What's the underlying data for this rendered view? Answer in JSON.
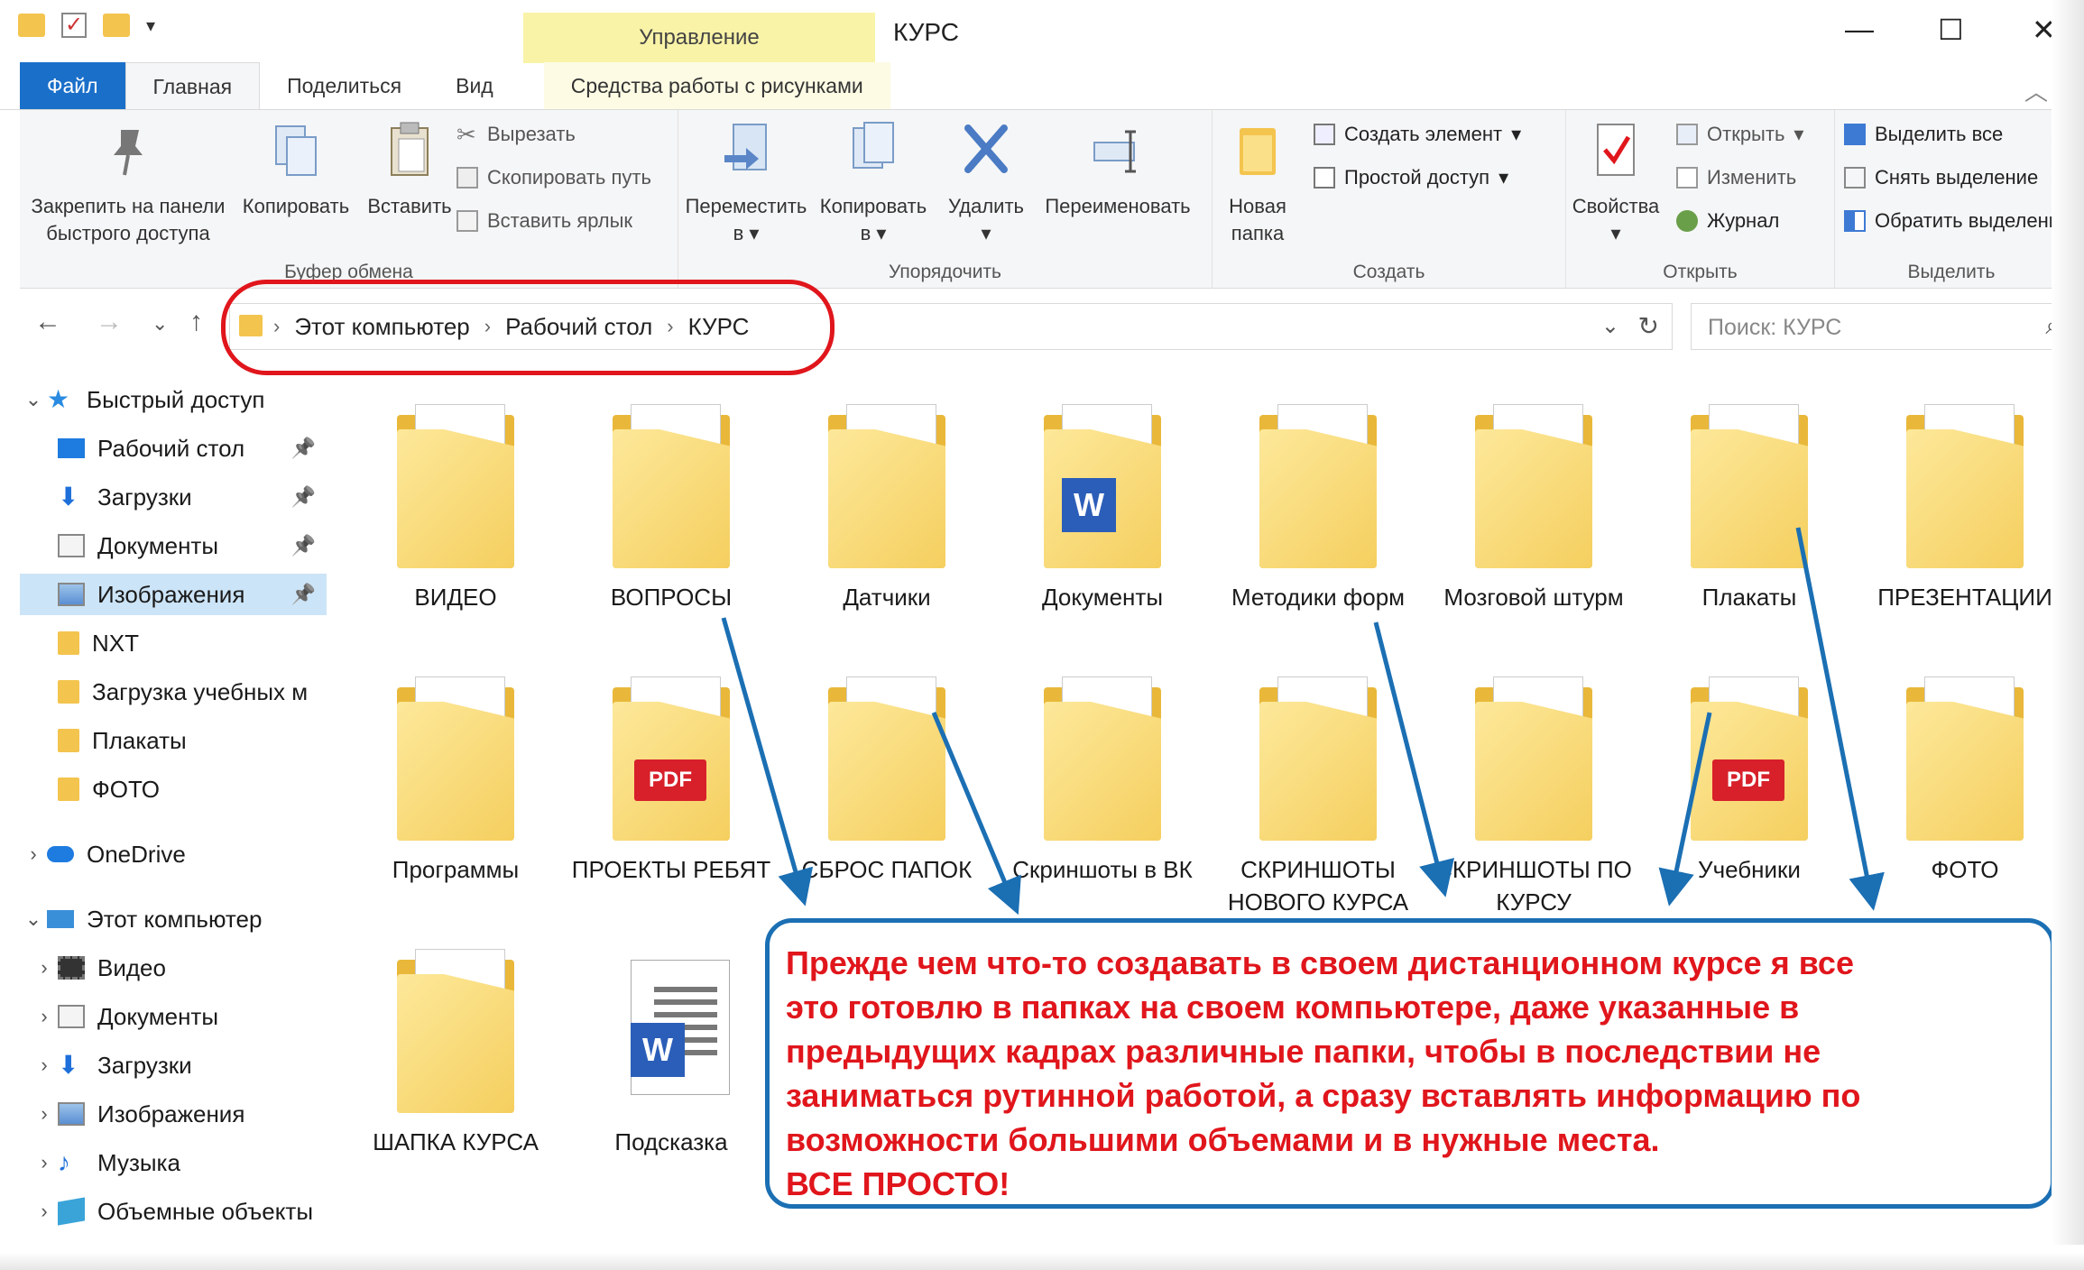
{
  "window": {
    "title": "КУРС",
    "context_tab": "Управление",
    "controls": {
      "minimize": "—",
      "maximize": "☐",
      "close": "✕"
    }
  },
  "tabs": [
    "Файл",
    "Главная",
    "Поделиться",
    "Вид",
    "Средства работы с рисунками"
  ],
  "ribbon": {
    "clipboard": {
      "group": "Буфер обмена",
      "pin": "Закрепить на панели быстрого доступа",
      "pin_l1": "Закрепить на панели",
      "pin_l2": "быстрого доступа",
      "copy": "Копировать",
      "paste": "Вставить",
      "cut": "Вырезать",
      "copy_path": "Скопировать путь",
      "paste_shortcut": "Вставить ярлык"
    },
    "organize": {
      "group": "Упорядочить",
      "move_l1": "Переместить",
      "move_l2": "в",
      "copy_l1": "Копировать",
      "copy_l2": "в",
      "delete": "Удалить",
      "rename": "Переименовать"
    },
    "create": {
      "group": "Создать",
      "new_folder_l1": "Новая",
      "new_folder_l2": "папка",
      "new_item": "Создать элемент",
      "easy_access": "Простой доступ"
    },
    "open": {
      "group": "Открыть",
      "properties": "Свойства",
      "open": "Открыть",
      "edit": "Изменить",
      "history": "Журнал"
    },
    "select": {
      "group": "Выделить",
      "select_all": "Выделить все",
      "select_none": "Снять выделение",
      "invert": "Обратить выделение"
    }
  },
  "address": {
    "crumbs": [
      "Этот компьютер",
      "Рабочий стол",
      "КУРС"
    ],
    "search_placeholder": "Поиск: КУРС"
  },
  "nav": [
    {
      "label": "Быстрый доступ",
      "icon": "star-icon",
      "expander": "⌄",
      "level": 0
    },
    {
      "label": "Рабочий стол",
      "icon": "desktop-icon",
      "pinned": true,
      "level": 1
    },
    {
      "label": "Загрузки",
      "icon": "download-icon",
      "pinned": true,
      "level": 1
    },
    {
      "label": "Документы",
      "icon": "documents-icon",
      "pinned": true,
      "level": 1
    },
    {
      "label": "Изображения",
      "icon": "pictures-icon",
      "pinned": true,
      "level": 1,
      "selected": true
    },
    {
      "label": "NXT",
      "icon": "folder-icon",
      "level": 1
    },
    {
      "label": "Загрузка учебных м",
      "icon": "folder-icon",
      "level": 1
    },
    {
      "label": "Плакаты",
      "icon": "folder-icon",
      "level": 1
    },
    {
      "label": "ФОТО",
      "icon": "folder-icon",
      "level": 1
    },
    {
      "label": "OneDrive",
      "icon": "onedrive-icon",
      "expander": "›",
      "level": 0
    },
    {
      "label": "Этот компьютер",
      "icon": "computer-icon",
      "expander": "⌄",
      "level": 0
    },
    {
      "label": "Видео",
      "icon": "video-icon",
      "expander": "›",
      "level": 1
    },
    {
      "label": "Документы",
      "icon": "documents-icon",
      "expander": "›",
      "level": 1
    },
    {
      "label": "Загрузки",
      "icon": "download-icon",
      "expander": "›",
      "level": 1
    },
    {
      "label": "Изображения",
      "icon": "pictures-icon",
      "expander": "›",
      "level": 1
    },
    {
      "label": "Музыка",
      "icon": "music-icon",
      "expander": "›",
      "level": 1
    },
    {
      "label": "Объемные объекты",
      "icon": "3d-objects-icon",
      "expander": "›",
      "level": 1
    }
  ],
  "folders": [
    {
      "label": "ВИДЕО",
      "type": "folder"
    },
    {
      "label": "ВОПРОСЫ",
      "type": "folder"
    },
    {
      "label": "Датчики",
      "type": "folder"
    },
    {
      "label": "Документы",
      "type": "folder",
      "badge": "W"
    },
    {
      "label": "Методики форм",
      "type": "folder"
    },
    {
      "label": "Мозговой штурм",
      "type": "folder"
    },
    {
      "label": "Плакаты",
      "type": "folder"
    },
    {
      "label": "ПРЕЗЕНТАЦИИ",
      "type": "folder"
    },
    {
      "label": "Программы",
      "type": "folder"
    },
    {
      "label": "ПРОЕКТЫ РЕБЯТ",
      "type": "folder",
      "badge": "PDF"
    },
    {
      "label": "СБРОС ПАПОК",
      "type": "folder"
    },
    {
      "label": "Скриншоты в ВК",
      "type": "folder"
    },
    {
      "label": "СКРИНШОТЫ НОВОГО КУРСА",
      "type": "folder"
    },
    {
      "label": "СКРИНШОТЫ ПО КУРСУ",
      "type": "folder"
    },
    {
      "label": "Учебники",
      "type": "folder",
      "badge": "PDF"
    },
    {
      "label": "ФОТО",
      "type": "folder"
    },
    {
      "label": "ШАПКА КУРСА",
      "type": "folder"
    },
    {
      "label": "Подсказка",
      "type": "word-file",
      "badge": "W"
    }
  ],
  "callout": {
    "line1": "Прежде чем что-то создавать в своем дистанционном курсе я все",
    "line2": "это готовлю в папках на своем компьютере, даже указанные в",
    "line3": "предыдущих кадрах различные папки, чтобы в последствии не",
    "line4": "заниматься рутинной работой, а сразу вставлять информацию по",
    "line5": "возможности большими объемами и в нужные места.",
    "line6": "ВСЕ ПРОСТО!"
  },
  "colors": {
    "accent": "#1a6fc9",
    "annotation_red": "#e0161c",
    "annotation_blue": "#1b6fb3",
    "folder": "#f3c44e",
    "selection": "#cce4f7"
  }
}
